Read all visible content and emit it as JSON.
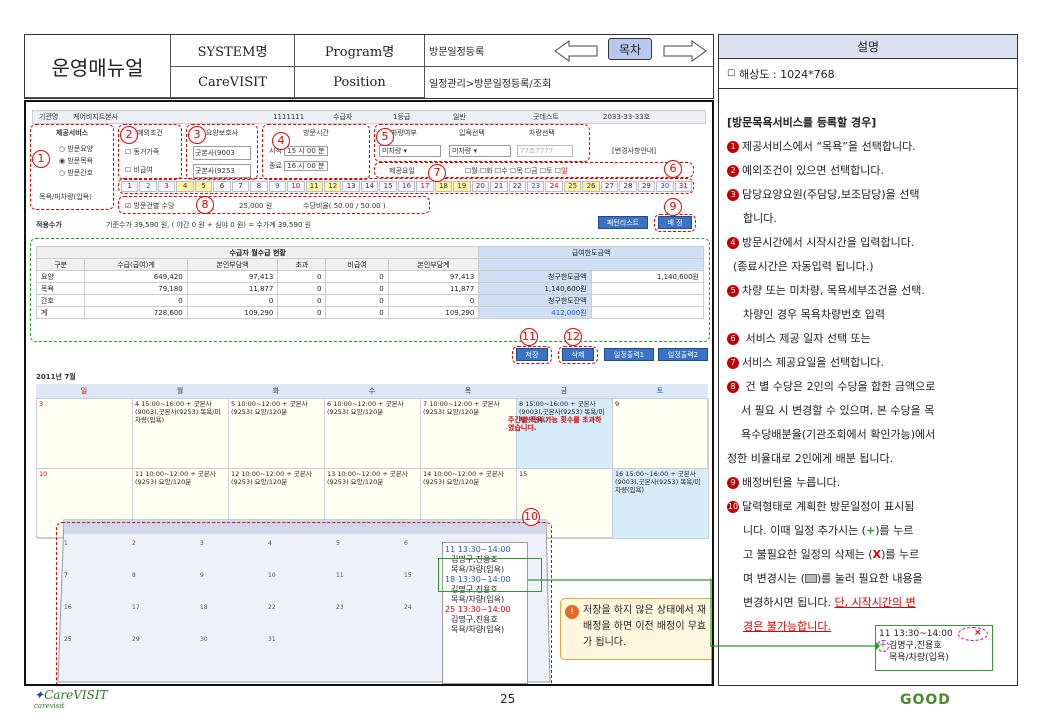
{
  "header": {
    "manual_title": "운영매뉴얼",
    "system_label": "SYSTEM명",
    "system_value": "CareVISIT",
    "program_label": "Program명",
    "position_label": "Position",
    "program_value": "방문일정등록",
    "position_value": "일정관리>방문일정등록/조회",
    "toc": "목차"
  },
  "right": {
    "title": "설명",
    "resolution": "해상도 : 1024*768",
    "heading": "[방문목욕서비스를 등록할 경우]",
    "lines": [
      "제공서비스에서 “목욕”을 선택합니다.",
      "예외조건이 있으면 선택합니다.",
      "담당요양요원(주담당,보조담당)을  선택",
      "합니다.",
      "방문시간에서 시작시간을 입력합니다.",
      "(종료시간은 자동입력 됩니다.)",
      "차량 또는 미차량, 목욕세부조건을 선택.",
      "차량인 경우 목욕차량번호 입력",
      " 서비스 제공 일자 선택  또는",
      "서비스 제공요일을 선택합니다.",
      " 건 별 수당은 2인의 수당을 합한 금액으로",
      "서 필요 시 변경할 수 있으며, 본 수당을 목",
      "욕수당배분율(기관조회에서  확인가능)에서",
      "정한 비율대로 2인에게 배분 됩니다.",
      "배정버턴을 누릅니다.",
      "달력형태로 계획한 방문일정이 표시됨",
      "니다. 이때 일정 추가시는 (",
      "고 불필요한 일정의 삭제는 (",
      "며 변경시는 (",
      "변경하시면 됩니다.",
      "경은 불가능합니다."
    ],
    "nums": [
      "1",
      "2",
      "3",
      "4",
      "5",
      "6",
      "7",
      "8",
      "9",
      "10"
    ],
    "tail_add": ")를 누르",
    "tail_del": ")를 누르",
    "tail_edit": ")를 눌러 필요한 내용을",
    "red_note": "단, 시작시간의 변"
  },
  "shot": {
    "topbar": [
      "기관명",
      "케어비지트본사",
      "1111111",
      "수급자",
      "1등급",
      "일반",
      "굿데스트",
      "2033-33-33호"
    ],
    "service_title": "제공서비스",
    "services": [
      "방문요양",
      "방문목욕",
      "방문간호"
    ],
    "service_note": "목욕/미차량(입욕)",
    "exception_title": "예외조건",
    "exceptions": [
      "동거가족",
      "비급여"
    ],
    "caregiver_title": "요양보호사",
    "caregivers": [
      "굿본사(9003",
      "굿본사(9253"
    ],
    "time_title": "방문시간",
    "time_start_label": "시작",
    "time_start": "15 시 00 분",
    "time_end_label": "종료",
    "time_end": "16 시 00 분",
    "car_title": "차량여부",
    "bath_title": "입욕선택",
    "carsel_title": "차량선택",
    "car_value": "미차량",
    "bath_value": "미차량",
    "car_no": "77조7777",
    "change_info": "[변경사항안내]",
    "weekday_title": "제공요일",
    "weekdays": [
      "월",
      "화",
      "수",
      "목",
      "금",
      "토",
      "일"
    ],
    "dates": [
      "1",
      "2",
      "3",
      "4",
      "5",
      "6",
      "7",
      "8",
      "9",
      "10",
      "11",
      "12",
      "13",
      "14",
      "15",
      "16",
      "17",
      "18",
      "19",
      "20",
      "21",
      "22",
      "23",
      "24",
      "25",
      "26",
      "27",
      "28",
      "29",
      "30",
      "31"
    ],
    "allow_label": "방문건별 수당",
    "allow_value": "25,000 원",
    "ratio": "수당비율( 50.00 / 50.00 )",
    "apply_label": "적용수가",
    "apply_value": "기준수가  39,590 원, ( 야간     0 원 + 심야     0 원) = 수가계  39,590 원",
    "btn_patient": "패턴리스트",
    "btn_assign": "배 정",
    "summary_title": "수급자 월수급 현황",
    "summary_limit": "급여한도금액",
    "summary_headers": [
      "구분",
      "수급(급여)계",
      "본인부담액",
      "초과",
      "비급여",
      "본인부담계"
    ],
    "summary_rows": [
      [
        "요양",
        "649,420",
        "97,413",
        "0",
        "0",
        "97,413",
        "청구한도금액",
        "1,140,600원"
      ],
      [
        "목욕",
        "79,180",
        "11,877",
        "0",
        "0",
        "11,877",
        "1,140,600원",
        ""
      ],
      [
        "간호",
        "0",
        "0",
        "0",
        "0",
        "0",
        "청구한도잔액",
        ""
      ],
      [
        "계",
        "728,600",
        "109,290",
        "0",
        "0",
        "109,290",
        "412,000원",
        ""
      ]
    ],
    "btns": [
      "저장",
      "삭제",
      "일정출력1",
      "일정출력2"
    ],
    "month": "2011년 7월",
    "days": [
      "일",
      "월",
      "화",
      "수",
      "목",
      "금",
      "토"
    ]
  },
  "calendar_rows": [
    [
      "3",
      "4  15:00~16:00  + 굿본사(9003),굿본사(9253) 목욕/미차량(입욕)",
      "5  10:00~12:00  + 굿본사(9253) 요양/120분",
      "6  10:00~12:00  + 굿본사(9253) 요양/120분",
      "7  10:00~12:00  + 굿본사(9253) 요양/120분",
      "8  15:00~16:00  + 굿본사(9003),굿본사(9253) 목욕/미차량(입욕)",
      "9"
    ],
    [
      "10",
      "11  10:00~12:00  + 굿본사(9253) 요양/120분",
      "12  10:00~12:00  + 굿본사(9253) 요양/120분",
      "13  10:00~12:00  + 굿본사(9253) 요양/120분",
      "14  10:00~12:00  + 굿본사(9253) 요양/120분",
      "15",
      "16  15:00~16:00  + 굿본사(9003),굿본사(9253) 목욕/미차량(입욕)"
    ]
  ],
  "warn_text": "주간별 목욕 가능 횟수를 초과하였습니다.",
  "zoom": {
    "entries": [
      "11 13:30~14:00",
      "김명구,진용호",
      "목욕/차량(입욕)",
      "18 13:30~14:00",
      "김명구,진용호",
      "목욕/차량(입욕)",
      "25 13:30~14:00",
      "김명구,진용호",
      "목욕/차량(입욕)"
    ],
    "nums": [
      "1",
      "2",
      "3",
      "4",
      "5",
      "6",
      "7",
      "8",
      "9",
      "10",
      "11",
      "15",
      "16",
      "17",
      "18",
      "22",
      "23",
      "24",
      "25",
      "29",
      "30",
      "31"
    ]
  },
  "note": {
    "text": "저장을 하지 않은 상태에서 재배정을 하면 이전 배정이 무효가 됩니다."
  },
  "mini": {
    "time": "11 13:30~14:00",
    "names": "김명구,진용호",
    "kind": "목욕/차량(입욕)"
  },
  "footer": {
    "logo": "CareVISIT",
    "logo_sub": "carevisit",
    "page": "25",
    "brand": "GOOD"
  },
  "markers": [
    "1",
    "2",
    "3",
    "4",
    "5",
    "6",
    "7",
    "8",
    "9",
    "10",
    "11",
    "12"
  ]
}
